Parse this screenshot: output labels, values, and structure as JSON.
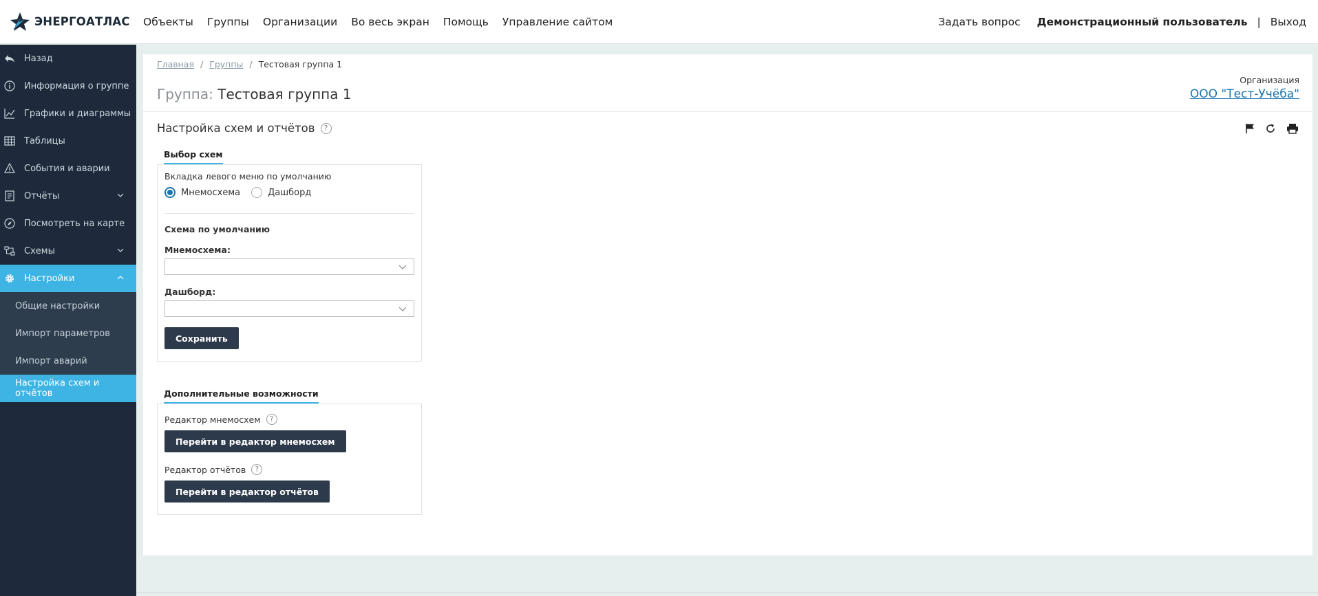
{
  "header": {
    "logo_text": "ЭНЕРГОАТЛАС",
    "nav": [
      "Объекты",
      "Группы",
      "Организации",
      "Во весь экран",
      "Помощь",
      "Управление сайтом"
    ],
    "ask": "Задать вопрос",
    "user": "Демонстрационный пользователь",
    "separator": "|",
    "logout": "Выход"
  },
  "sidebar": {
    "items": [
      {
        "label": "Назад",
        "icon": "back-arrow-icon"
      },
      {
        "label": "Информация о группе",
        "icon": "info-icon"
      },
      {
        "label": "Графики и диаграммы",
        "icon": "line-chart-icon"
      },
      {
        "label": "Таблицы",
        "icon": "table-icon"
      },
      {
        "label": "События и аварии",
        "icon": "warning-icon"
      },
      {
        "label": "Отчёты",
        "icon": "report-icon",
        "expandable": true
      },
      {
        "label": "Посмотреть на карте",
        "icon": "compass-icon"
      },
      {
        "label": "Схемы",
        "icon": "scheme-icon",
        "expandable": true
      },
      {
        "label": "Настройки",
        "icon": "gear-icon",
        "expandable": true,
        "active": true
      }
    ],
    "subitems": [
      {
        "label": "Общие настройки"
      },
      {
        "label": "Импорт параметров"
      },
      {
        "label": "Импорт аварий"
      },
      {
        "label": "Настройка схем и отчётов",
        "active": true
      }
    ]
  },
  "breadcrumb": {
    "home": "Главная",
    "groups": "Группы",
    "current": "Тестовая группа 1",
    "sep": "/"
  },
  "page": {
    "title_label": "Группа:",
    "title_value": "Тестовая группа 1",
    "org_label": "Организация",
    "org_name": "ООО \"Тест-Учёба\"",
    "section_title": "Настройка схем и отчётов",
    "help_glyph": "?"
  },
  "schemes": {
    "tab_title": "Выбор схем",
    "default_tab_label": "Вкладка левого меню по умолчанию",
    "radio_mnemo": "Мнемосхема",
    "radio_dashboard": "Дашборд",
    "selected_radio": "Мнемосхема",
    "default_scheme_label": "Схема по умолчанию",
    "mnemo_label": "Мнемосхема:",
    "mnemo_value": "",
    "dashboard_label": "Дашборд:",
    "dashboard_value": "",
    "save_button": "Сохранить"
  },
  "extra": {
    "tab_title": "Дополнительные возможности",
    "mnemo_editor_label": "Редактор мнемосхем",
    "mnemo_editor_button": "Перейти в редактор мнемосхем",
    "report_editor_label": "Редактор отчётов",
    "report_editor_button": "Перейти в редактор отчётов"
  },
  "colors": {
    "sidebar_bg": "#1e2a3b",
    "accent": "#3db4e4",
    "button_bg": "#2d3a4b",
    "link": "#1c74b0"
  }
}
